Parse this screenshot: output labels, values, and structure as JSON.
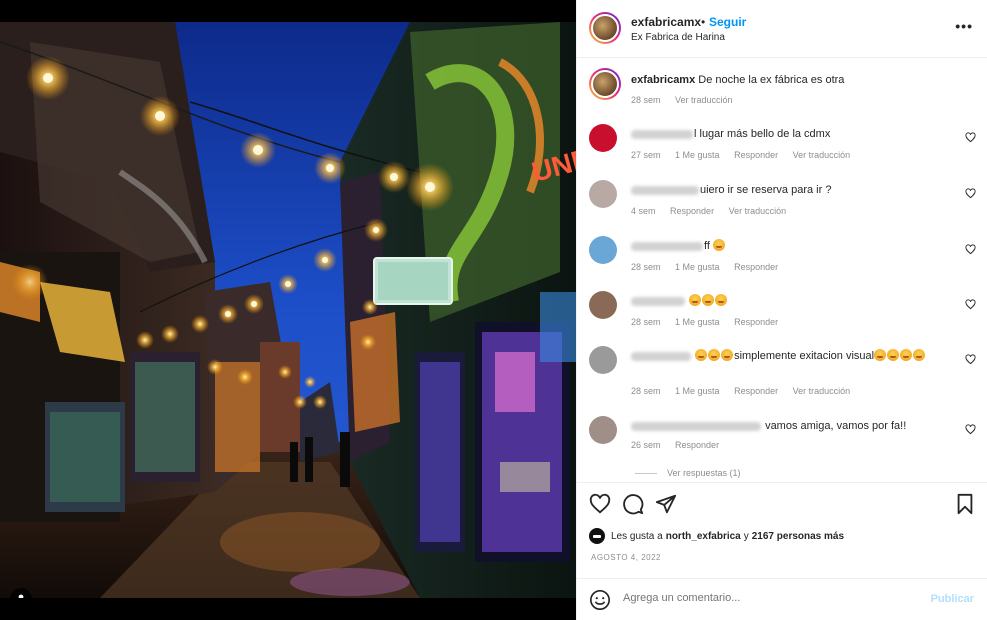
{
  "post": {
    "username": "exfabricamx",
    "separator": "•",
    "follow_label": "Seguir",
    "location": "Ex Fabrica de Harina",
    "more": "•••"
  },
  "caption": {
    "username": "exfabricamx",
    "text": "De noche la ex fábrica es otra",
    "time": "28 sem",
    "translate": "Ver traducción"
  },
  "comments": [
    {
      "text": "l lugar más bello de la cdmx",
      "time": "27 sem",
      "likes": "1 Me gusta",
      "reply": "Responder",
      "translate": "Ver traducción",
      "avatar_color": "#c8102e"
    },
    {
      "text": "uiero ir se reserva para ir ?",
      "time": "4 sem",
      "likes": "",
      "reply": "Responder",
      "translate": "Ver traducción",
      "avatar_color": "#b8a9a4"
    },
    {
      "text": "ff",
      "time": "28 sem",
      "likes": "1 Me gusta",
      "reply": "Responder",
      "translate": "",
      "avatar_color": "#6aa6d6"
    },
    {
      "text": "",
      "time": "28 sem",
      "likes": "1 Me gusta",
      "reply": "Responder",
      "translate": "",
      "avatar_color": "#8a6a56"
    },
    {
      "text": "simplemente exitacion visual",
      "time": "28 sem",
      "likes": "1 Me gusta",
      "reply": "Responder",
      "translate": "Ver traducción",
      "avatar_color": "#9a9a9a"
    },
    {
      "text": "vamos amiga, vamos por fa!!",
      "time": "26 sem",
      "likes": "",
      "reply": "Responder",
      "translate": "",
      "avatar_color": "#a08e88"
    }
  ],
  "view_replies": "Ver respuestas (1)",
  "likes": {
    "prefix": "Les gusta a",
    "user": "north_exfabrica",
    "connector": "y",
    "others": "2167 personas más"
  },
  "date": "AGOSTO 4, 2022",
  "add_comment": {
    "placeholder": "Agrega un comentario...",
    "publish": "Publicar"
  },
  "icons": [
    "heart-icon",
    "comment-icon",
    "share-icon",
    "bookmark-icon",
    "emoji-icon",
    "tagged-user-icon",
    "more-icon"
  ],
  "colors": {
    "accent": "#0095f6",
    "text": "#262626",
    "muted": "#8e8e8e",
    "publish_disabled": "#b2dffc"
  }
}
